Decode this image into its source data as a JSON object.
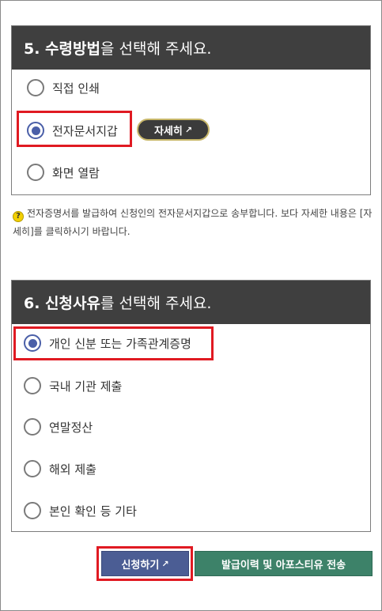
{
  "section5": {
    "header_bold": "5. 수령방법",
    "header_rest": "을 선택해 주세요.",
    "options": [
      {
        "label": "직접 인쇄",
        "selected": false
      },
      {
        "label": "전자문서지갑",
        "selected": true
      },
      {
        "label": "화면 열람",
        "selected": false
      }
    ],
    "detail_button": "자세히",
    "detail_icon": "external-link-icon"
  },
  "notice": {
    "icon": "question-icon",
    "icon_glyph": "?",
    "text": "전자증명서를 발급하여 신청인의 전자문서지갑으로 송부합니다. 보다 자세한 내용은 [자세히]를 클릭하시기 바랍니다."
  },
  "section6": {
    "header_bold": "6. 신청사유",
    "header_rest": "를 선택해 주세요.",
    "options": [
      {
        "label": "개인 신분 또는 가족관계증명",
        "selected": true
      },
      {
        "label": "국내 기관 제출",
        "selected": false
      },
      {
        "label": "연말정산",
        "selected": false
      },
      {
        "label": "해외 제출",
        "selected": false
      },
      {
        "label": "본인 확인 등 기타",
        "selected": false
      }
    ]
  },
  "buttons": {
    "apply": "신청하기",
    "history": "발급이력 및 아포스티유 전송"
  },
  "colors": {
    "header_bg": "#3f3f3f",
    "radio_selected": "#4a5fa8",
    "highlight": "#e01a22",
    "apply_bg": "#4b5d94",
    "history_bg": "#3d8269"
  }
}
